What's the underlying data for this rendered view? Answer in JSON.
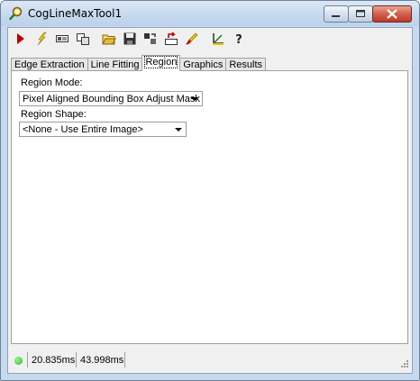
{
  "window": {
    "title": "CogLineMaxTool1"
  },
  "toolbar": {
    "buttons": [
      {
        "icon": "run-icon"
      },
      {
        "icon": "electric-icon"
      },
      {
        "icon": "image-icon"
      },
      {
        "icon": "copy-icon"
      },
      {
        "icon": "open-folder-icon"
      },
      {
        "icon": "save-icon"
      },
      {
        "icon": "copy-properties-icon"
      },
      {
        "icon": "reset-icon"
      },
      {
        "icon": "graphics-icon"
      },
      {
        "icon": "location-icon"
      },
      {
        "icon": "help-icon"
      }
    ]
  },
  "tabs": [
    {
      "label": "Edge Extraction",
      "active": false
    },
    {
      "label": "Line Fitting",
      "active": false
    },
    {
      "label": "Region",
      "active": true
    },
    {
      "label": "Graphics",
      "active": false
    },
    {
      "label": "Results",
      "active": false
    }
  ],
  "region": {
    "mode_label": "Region Mode:",
    "mode_value": "Pixel Aligned Bounding Box Adjust Mask",
    "shape_label": "Region Shape:",
    "shape_value": "<None - Use Entire Image>"
  },
  "status": {
    "led_color": "#2db52d",
    "time1": "20.835ms",
    "time2": "43.998ms"
  }
}
